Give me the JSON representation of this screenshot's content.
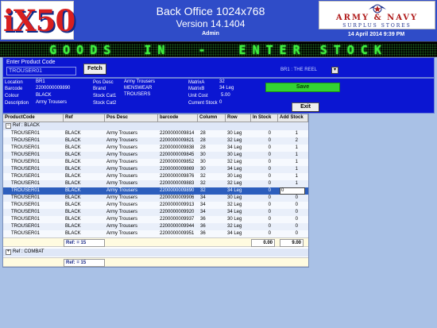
{
  "header": {
    "logo": "iX50",
    "title": "Back Office 1024x768",
    "version": "Version 14.1404",
    "user": "Admin",
    "brand_line1": "ARMY & NAVY",
    "brand_line2": "SURPLUS STORES",
    "date": "14 April 2014 9:39 PM"
  },
  "banner": {
    "text": "GOODS  IN  -  ENTER STOCK"
  },
  "entry": {
    "label": "Enter Product Code",
    "value": "TROUSER01",
    "fetch_label": "Fetch",
    "location_select": "BR1 : THE REEL",
    "dropdown_glyph": "▾"
  },
  "details": {
    "location_label": "Location",
    "location": "BR1",
    "barcode_label": "Barcode",
    "barcode": "2200000009890",
    "colour_label": "Colour",
    "colour": "BLACK",
    "description_label": "Description",
    "description": "Army Trousers",
    "pos_desc_label": "Pos Desc",
    "pos_desc": "Army Trousers",
    "brand_label": "Brand",
    "brand": "MENSWEAR",
    "stock_cat1_label": "Stock Cat1",
    "stock_cat1": "TROUSERS",
    "stock_cat2_label": "Stock Cat2",
    "stock_cat2": "",
    "matrix_a_label": "MatrixA",
    "matrix_a": "32",
    "matrix_b_label": "MatrixB",
    "matrix_b": "34 Leg",
    "unit_cost_label": "Unit Cost",
    "unit_cost": "5.00",
    "current_stock_label": "Current Stock",
    "current_stock": "0",
    "save_label": "Save",
    "exit_label": "Exit"
  },
  "grid": {
    "columns": [
      "ProductCode",
      "Ref",
      "Pos Desc",
      "barcode",
      "Column",
      "Row",
      "In Stock",
      "Add Stock"
    ],
    "groups": [
      {
        "label": "Ref : BLACK",
        "expander": "−",
        "summary_label": "Ref: = 15",
        "in_stock_total": "0.00",
        "add_stock_total": "9.00"
      },
      {
        "label": "Ref : COMBAT",
        "expander": "+",
        "summary_label": "Ref: = 15"
      }
    ],
    "rows": [
      [
        "TROUSER01",
        "BLACK",
        "Army Trousers",
        "2200000009814",
        "28",
        "30 Leg",
        "0",
        "1"
      ],
      [
        "TROUSER01",
        "BLACK",
        "Army Trousers",
        "2200000009821",
        "28",
        "32 Leg",
        "0",
        "2"
      ],
      [
        "TROUSER01",
        "BLACK",
        "Army Trousers",
        "2200000009838",
        "28",
        "34 Leg",
        "0",
        "1"
      ],
      [
        "TROUSER01",
        "BLACK",
        "Army Trousers",
        "2200000009845",
        "30",
        "30 Leg",
        "0",
        "1"
      ],
      [
        "TROUSER01",
        "BLACK",
        "Army Trousers",
        "2200000009852",
        "30",
        "32 Leg",
        "0",
        "1"
      ],
      [
        "TROUSER01",
        "BLACK",
        "Army Trousers",
        "2200000009869",
        "30",
        "34 Leg",
        "0",
        "1"
      ],
      [
        "TROUSER01",
        "BLACK",
        "Army Trousers",
        "2200000009876",
        "32",
        "30 Leg",
        "0",
        "1"
      ],
      [
        "TROUSER01",
        "BLACK",
        "Army Trousers",
        "2200000009883",
        "32",
        "32 Leg",
        "0",
        "1"
      ],
      [
        "TROUSER01",
        "BLACK",
        "Army Trousers",
        "2200000009890",
        "32",
        "34 Leg",
        "0",
        "0"
      ],
      [
        "TROUSER01",
        "BLACK",
        "Army Trousers",
        "2200000009906",
        "34",
        "30 Leg",
        "0",
        "0"
      ],
      [
        "TROUSER01",
        "BLACK",
        "Army Trousers",
        "2200000009913",
        "34",
        "32 Leg",
        "0",
        "0"
      ],
      [
        "TROUSER01",
        "BLACK",
        "Army Trousers",
        "2200000009920",
        "34",
        "34 Leg",
        "0",
        "0"
      ],
      [
        "TROUSER01",
        "BLACK",
        "Army Trousers",
        "2200000009937",
        "36",
        "30 Leg",
        "0",
        "0"
      ],
      [
        "TROUSER01",
        "BLACK",
        "Army Trousers",
        "2200000009944",
        "36",
        "32 Leg",
        "0",
        "0"
      ],
      [
        "TROUSER01",
        "BLACK",
        "Army Trousers",
        "2200000009951",
        "36",
        "34 Leg",
        "0",
        "0"
      ]
    ],
    "selected_row": 8
  },
  "colors": {
    "header_bg": "#2f4cc8",
    "panel_bg": "#0b16d2",
    "led_text": "#3fef3f",
    "save_button": "#33d233",
    "selected_row": "#2c5ebd",
    "desktop_bg": "#a9c1e6"
  }
}
